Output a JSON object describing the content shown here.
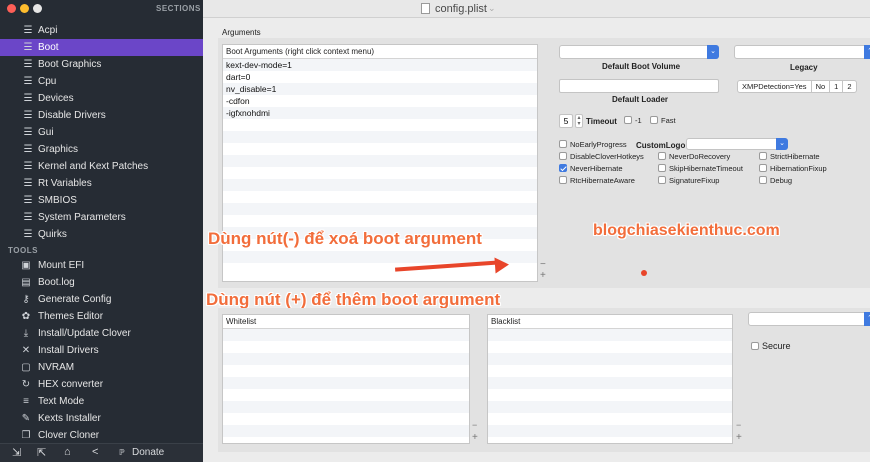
{
  "window": {
    "title": "config.plist"
  },
  "sidebar": {
    "sections_label": "SECTIONS",
    "tools_label": "TOOLS",
    "items": [
      {
        "icon": "list-icon",
        "label": "Acpi"
      },
      {
        "icon": "list-icon",
        "label": "Boot",
        "selected": true
      },
      {
        "icon": "list-icon",
        "label": "Boot Graphics"
      },
      {
        "icon": "list-icon",
        "label": "Cpu"
      },
      {
        "icon": "list-icon",
        "label": "Devices"
      },
      {
        "icon": "list-icon",
        "label": "Disable Drivers"
      },
      {
        "icon": "list-icon",
        "label": "Gui"
      },
      {
        "icon": "list-icon",
        "label": "Graphics"
      },
      {
        "icon": "list-icon",
        "label": "Kernel and Kext Patches"
      },
      {
        "icon": "list-icon",
        "label": "Rt Variables"
      },
      {
        "icon": "list-icon",
        "label": "SMBIOS"
      },
      {
        "icon": "list-icon",
        "label": "System Parameters"
      },
      {
        "icon": "list-icon",
        "label": "Quirks"
      }
    ],
    "tools": [
      {
        "icon": "disk-icon",
        "label": "Mount EFI"
      },
      {
        "icon": "log-icon",
        "label": "Boot.log"
      },
      {
        "icon": "keys-icon",
        "label": "Generate Config"
      },
      {
        "icon": "palette-icon",
        "label": "Themes Editor"
      },
      {
        "icon": "download-icon",
        "label": "Install/Update Clover"
      },
      {
        "icon": "wrench-icon",
        "label": "Install Drivers"
      },
      {
        "icon": "chip-icon",
        "label": "NVRAM"
      },
      {
        "icon": "refresh-icon",
        "label": "HEX converter"
      },
      {
        "icon": "lines-icon",
        "label": "Text Mode"
      },
      {
        "icon": "puzzle-icon",
        "label": "Kexts Installer"
      },
      {
        "icon": "copy-icon",
        "label": "Clover Cloner"
      }
    ],
    "bottom": {
      "donate_label": "Donate"
    }
  },
  "arguments": {
    "section_label": "Arguments",
    "header": "Boot Arguments (right click context menu)",
    "rows": [
      "kext-dev-mode=1",
      "dart=0",
      "nv_disable=1",
      "-cdfon",
      "-igfxnohdmi",
      "",
      "",
      "",
      "",
      "",
      "",
      "",
      "",
      "",
      "",
      "",
      "",
      ""
    ]
  },
  "boot": {
    "default_volume_label": "Default Boot Volume",
    "legacy_label": "Legacy",
    "default_loader_label": "Default Loader",
    "xmp_segments": [
      "XMPDetection=Yes",
      "No",
      "1",
      "2"
    ],
    "timeout_value": "5",
    "timeout_label": "Timeout",
    "minus_one_label": "-1",
    "fast_label": "Fast",
    "no_early_progress": "NoEarlyProgress",
    "custom_logo_label": "CustomLogo",
    "options": [
      {
        "label": "DisableCloverHotkeys",
        "checked": false
      },
      {
        "label": "NeverDoRecovery",
        "checked": false
      },
      {
        "label": "StrictHibernate",
        "checked": false
      },
      {
        "label": "NeverHibernate",
        "checked": true
      },
      {
        "label": "SkipHibernateTimeout",
        "checked": false
      },
      {
        "label": "HibernationFixup",
        "checked": false
      },
      {
        "label": "RtcHibernateAware",
        "checked": false
      },
      {
        "label": "SignatureFixup",
        "checked": false
      },
      {
        "label": "Debug",
        "checked": false
      }
    ]
  },
  "lists": {
    "whitelist_header": "Whitelist",
    "blacklist_header": "Blacklist",
    "secure_label": "Secure"
  },
  "annotations": {
    "remove_text": "Dùng nút(-) để xoá boot argument",
    "add_text": "Dùng nút (+) để thêm boot argument",
    "blog_text": "blogchiasekienthuc.com",
    "color": "#f26d3b"
  },
  "colors": {
    "sidebar_bg": "#262c34",
    "selected": "#6b46c8",
    "accent_blue": "#3f7ae0"
  }
}
